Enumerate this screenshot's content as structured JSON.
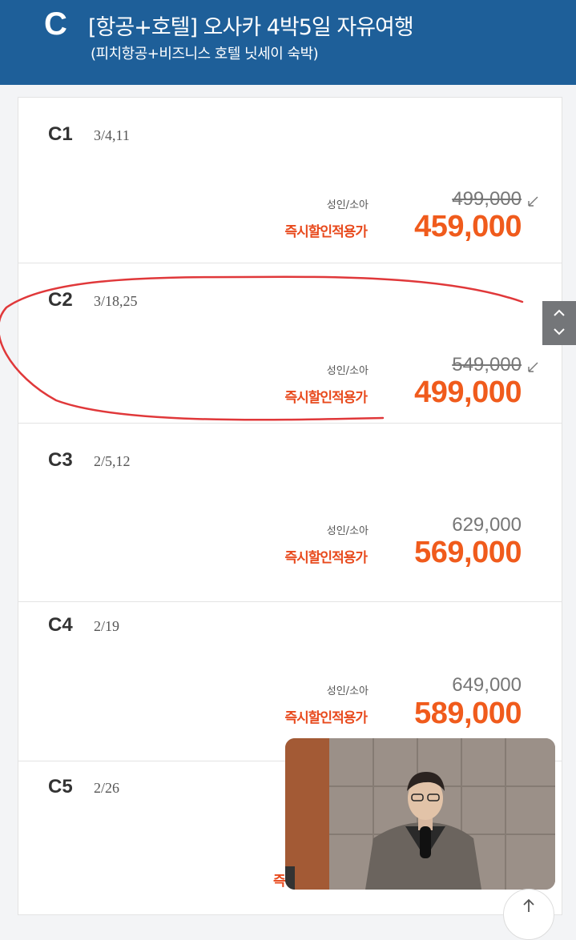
{
  "header": {
    "letter": "C",
    "title": "[항공+호텔] 오사카 4박5일 자유여행",
    "subtitle": "(피치항공+비즈니스 호텔 닛세이 숙박)"
  },
  "rows": [
    {
      "code": "C1",
      "dates": "3/4,11",
      "age_label": "성인/소아",
      "original_price": "499,000",
      "discount_label": "즉시할인적용가",
      "sale_price": "459,000"
    },
    {
      "code": "C2",
      "dates": "3/18,25",
      "age_label": "성인/소아",
      "original_price": "549,000",
      "discount_label": "즉시할인적용가",
      "sale_price": "499,000"
    },
    {
      "code": "C3",
      "dates": "2/5,12",
      "age_label": "성인/소아",
      "original_price": "629,000",
      "discount_label": "즉시할인적용가",
      "sale_price": "569,000"
    },
    {
      "code": "C4",
      "dates": "2/19",
      "age_label": "성인/소아",
      "original_price": "649,000",
      "discount_label": "즉시할인적용가",
      "sale_price": "589,000"
    },
    {
      "code": "C5",
      "dates": "2/26",
      "discount_label_partial": "즉"
    }
  ],
  "icons": {
    "scroll_up": "chevron-up-icon",
    "scroll_down": "chevron-down-icon",
    "back_to_top": "arrow-up-icon"
  },
  "colors": {
    "header_bg": "#1e5f99",
    "sale_price": "#f05b1c",
    "annotation": "#e0383a"
  }
}
